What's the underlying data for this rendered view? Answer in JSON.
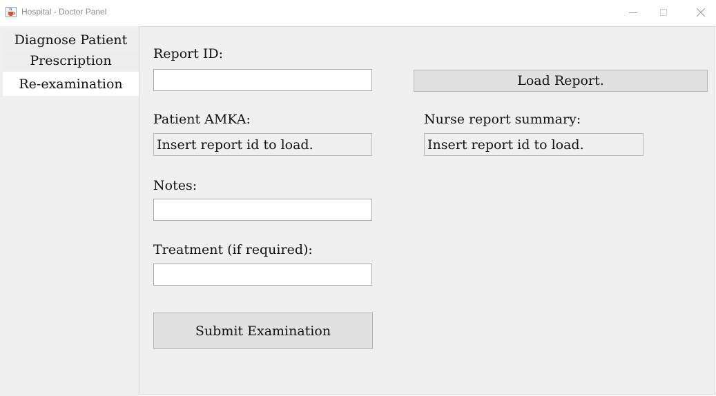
{
  "window": {
    "title": "Hospital - Doctor Panel",
    "icon": "java-cup-icon"
  },
  "sidebar": {
    "tabs": [
      {
        "label": "Diagnose Patient",
        "selected": false
      },
      {
        "label": "Prescription",
        "selected": false
      },
      {
        "label": "Re-examination",
        "selected": true
      }
    ]
  },
  "form": {
    "report_id_label": "Report ID:",
    "report_id_value": "",
    "load_button": "Load Report.",
    "patient_amka_label": "Patient AMKA:",
    "patient_amka_value": "Insert report id to load.",
    "nurse_summary_label": "Nurse report summary:",
    "nurse_summary_value": "Insert report id to load.",
    "notes_label": "Notes:",
    "notes_value": "",
    "treatment_label": "Treatment (if required):",
    "treatment_value": "",
    "submit_button": "Submit Examination"
  }
}
